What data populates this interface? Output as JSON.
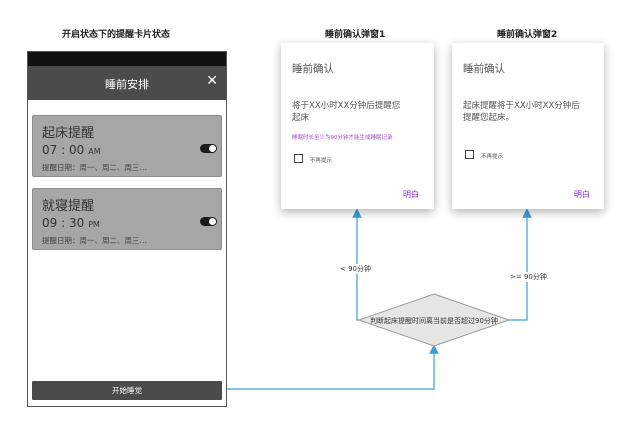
{
  "captions": {
    "left": "开启状态下的提醒卡片状态",
    "dialog1": "睡前确认弹窗1",
    "dialog2": "睡前确认弹窗2"
  },
  "phone": {
    "title": "睡前安排",
    "close_glyph": "✕",
    "cards": [
      {
        "title": "起床提醒",
        "time": "07 : 00",
        "ampm": "AM",
        "days": "提醒日期：周一、周二、周三…",
        "enabled": true
      },
      {
        "title": "就寝提醒",
        "time": "09 : 30",
        "ampm": "PM",
        "days": "提醒日期：周一、周二、周三…",
        "enabled": true
      }
    ],
    "start_button": "开始睡觉"
  },
  "dialog1": {
    "title": "睡前确认",
    "body": "将于XX小时XX分钟后提醒您起床",
    "note": "睡眠时长至少为90分钟才能生成睡眠记录",
    "checkbox_label": "不再提示",
    "button": "明白"
  },
  "dialog2": {
    "title": "睡前确认",
    "body": "起床提醒将于XX小时XX分钟后提醒您起床。",
    "checkbox_label": "不再提示",
    "button": "明白"
  },
  "flow": {
    "decision": "判断起床提醒时间离当前是否超过90分钟",
    "branch_less": "< 90分钟",
    "branch_more": ">= 90分钟"
  },
  "colors": {
    "arrow": "#3a9fd8",
    "accent": "#8a2be2",
    "note": "#a64dd6",
    "header_bg": "#4b4b4b",
    "card_bg": "#a6a6a6"
  },
  "icons": {
    "close": "close-icon",
    "toggle": "toggle-switch-icon",
    "checkbox": "checkbox-icon"
  }
}
